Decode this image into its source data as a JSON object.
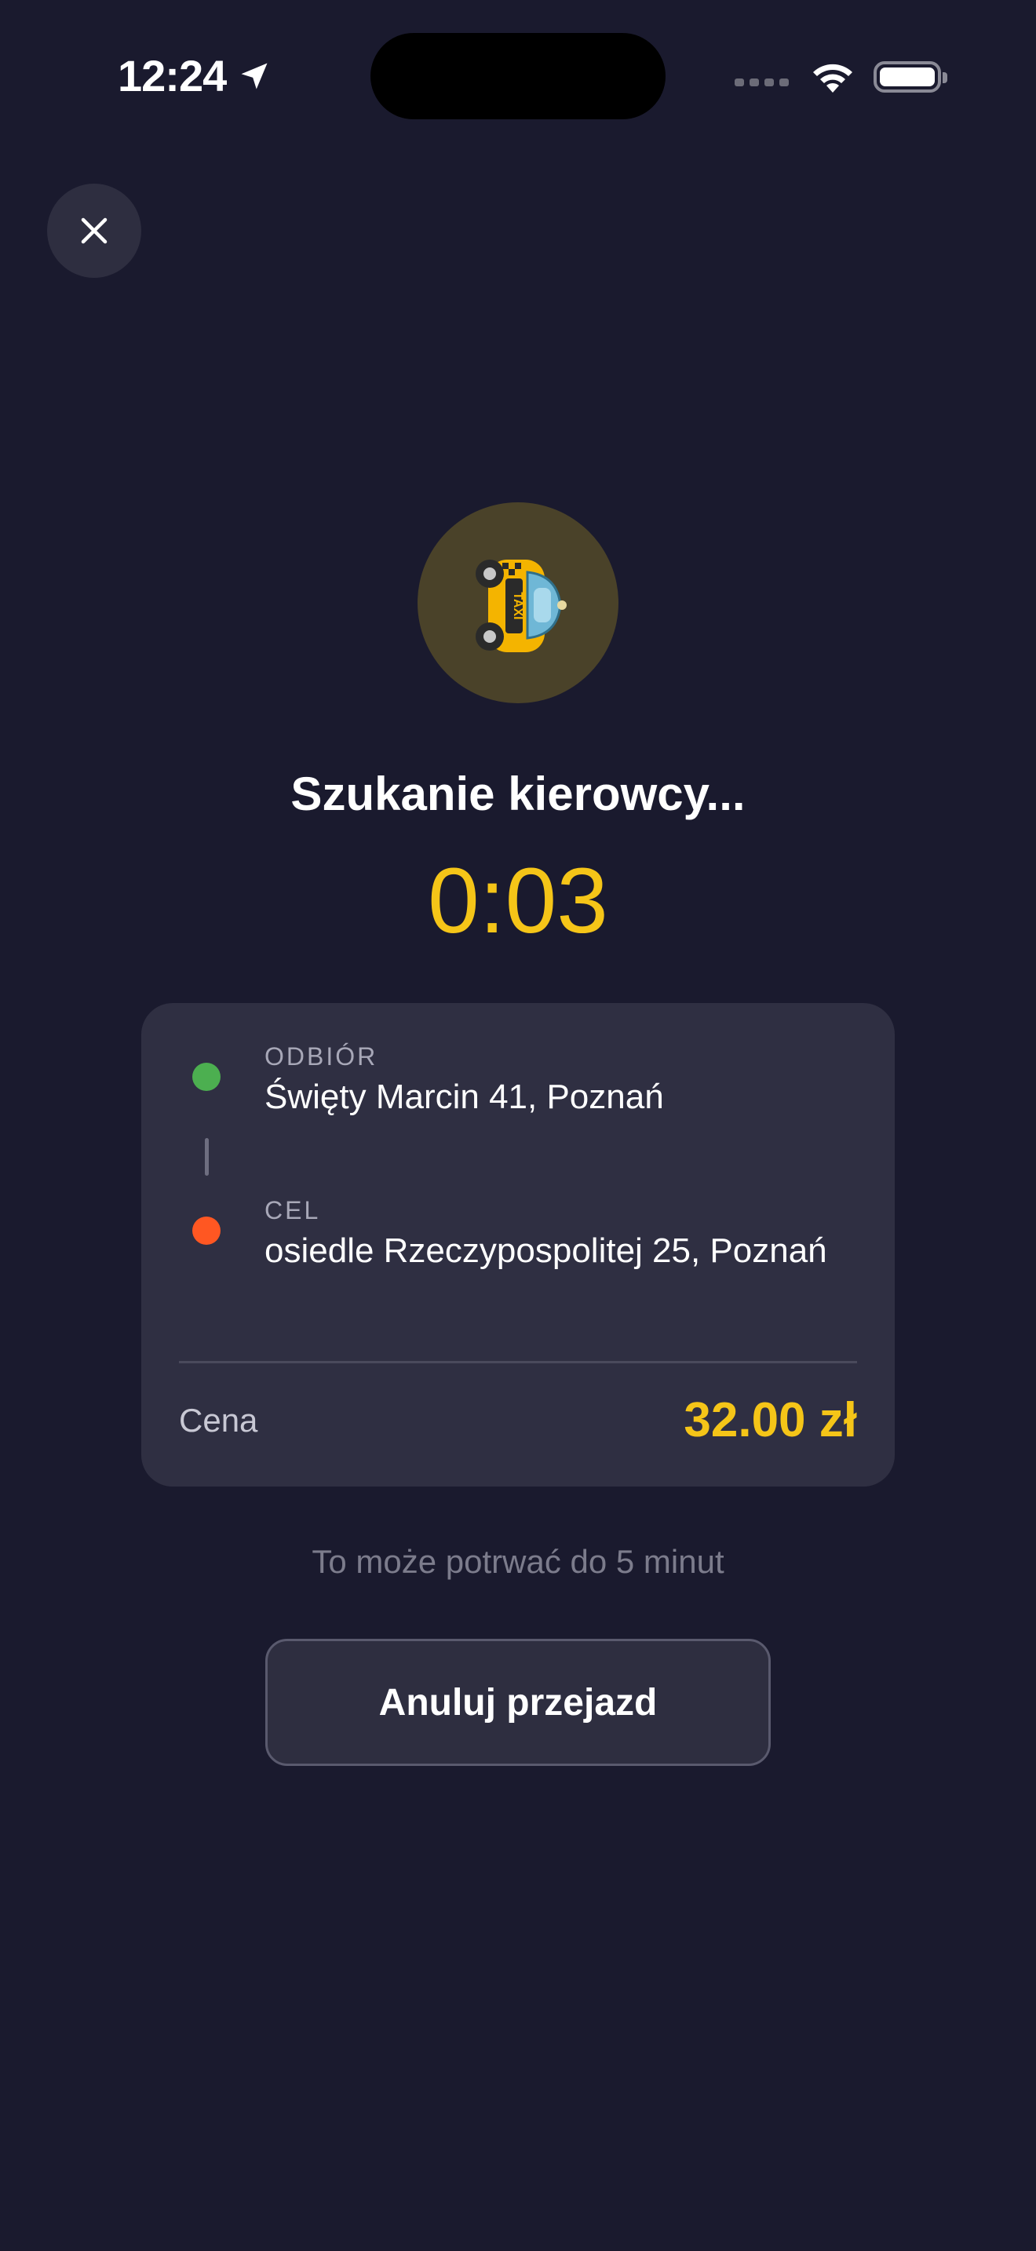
{
  "status_bar": {
    "time": "12:24",
    "icons": [
      "location-arrow-icon",
      "cellular-signal-icon",
      "wifi-icon",
      "battery-icon"
    ]
  },
  "header": {
    "close_icon": "close-icon"
  },
  "search": {
    "icon": "taxi-icon",
    "title": "Szukanie kierowcy...",
    "timer": "0:03"
  },
  "trip": {
    "pickup_label": "ODBIÓR",
    "pickup_address": "Święty Marcin 41, Poznań",
    "destination_label": "CEL",
    "destination_address": "osiedle Rzeczypospolitej 25, Poznań",
    "price_label": "Cena",
    "price_value": "32.00 zł"
  },
  "hint": "To może potrwać do 5 minut",
  "actions": {
    "cancel_label": "Anuluj przejazd"
  },
  "colors": {
    "background": "#1a1a2e",
    "card": "#2f2f42",
    "accent": "#f5c518",
    "pickup_dot": "#4caf50",
    "destination_dot": "#ff5722"
  }
}
